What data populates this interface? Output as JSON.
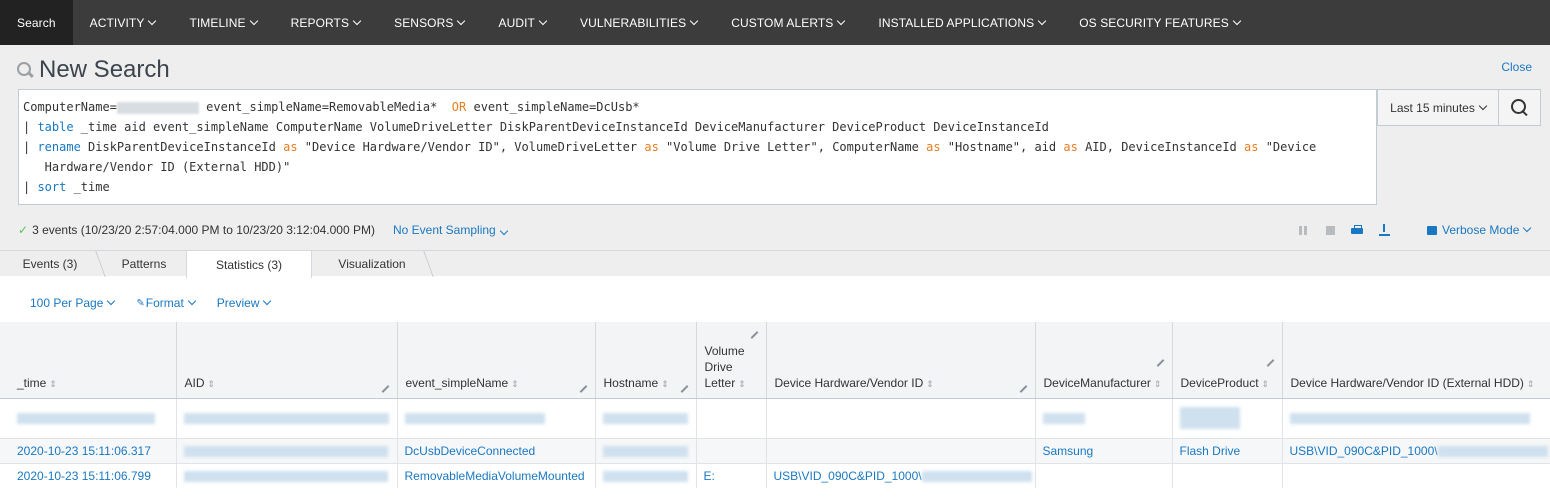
{
  "nav": {
    "items": [
      {
        "label": "Search",
        "active": true,
        "dropdown": false
      },
      {
        "label": "ACTIVITY",
        "dropdown": true
      },
      {
        "label": "TIMELINE",
        "dropdown": true
      },
      {
        "label": "REPORTS",
        "dropdown": true
      },
      {
        "label": "SENSORS",
        "dropdown": true
      },
      {
        "label": "AUDIT",
        "dropdown": true
      },
      {
        "label": "VULNERABILITIES",
        "dropdown": true
      },
      {
        "label": "CUSTOM ALERTS",
        "dropdown": true
      },
      {
        "label": "INSTALLED APPLICATIONS",
        "dropdown": true
      },
      {
        "label": "OS SECURITY FEATURES",
        "dropdown": true
      }
    ]
  },
  "search": {
    "title": "New Search",
    "close_label": "Close",
    "time_range": "Last 15 minutes",
    "query": {
      "l1_a": "ComputerName=",
      "l1_b": " event_simpleName=RemovableMedia*  ",
      "l1_or": "OR",
      "l1_c": " event_simpleName=DcUsb*",
      "pipe": "| ",
      "table_kw": "table",
      "table_args": " _time aid event_simpleName ComputerName VolumeDriveLetter DiskParentDeviceInstanceId DeviceManufacturer DeviceProduct DeviceInstanceId",
      "rename_kw": "rename",
      "as_kw": "as",
      "r1": " DiskParentDeviceInstanceId ",
      "r2": " \"Device Hardware/Vendor ID\", VolumeDriveLetter ",
      "r3": " \"Volume Drive Letter\", ComputerName ",
      "r4": " \"Hostname\", aid ",
      "r5": " AID, DeviceInstanceId ",
      "r6": " \"Device",
      "r7": "   Hardware/Vendor ID (External HDD)\"",
      "sort_kw": "sort",
      "sort_args": " _time"
    }
  },
  "status": {
    "check": "✓",
    "events_summary": "3 events (10/23/20 2:57:04.000 PM to 10/23/20 3:12:04.000 PM)",
    "sampling": "No Event Sampling",
    "mode": "Verbose Mode"
  },
  "tabs": [
    {
      "label": "Events (3)"
    },
    {
      "label": "Patterns"
    },
    {
      "label": "Statistics (3)",
      "active": true
    },
    {
      "label": "Visualization"
    }
  ],
  "options": {
    "per_page": "100 Per Page",
    "format": "Format",
    "preview": "Preview"
  },
  "table": {
    "columns": [
      "_time",
      "AID",
      "event_simpleName",
      "Hostname",
      "Volume Drive Letter",
      "Device Hardware/Vendor ID",
      "DeviceManufacturer",
      "DeviceProduct",
      "Device Hardware/Vendor ID (External HDD)"
    ],
    "rows": [
      {
        "time": "2020-10-23 15:11:06.317",
        "event": "DcUsbDeviceConnected",
        "drive": "",
        "hwid": "",
        "manufacturer": "Samsung",
        "product": "Flash Drive",
        "ext": "USB\\VID_090C&PID_1000\\"
      },
      {
        "time": "2020-10-23 15:11:06.799",
        "event": "RemovableMediaVolumeMounted",
        "drive": "E:",
        "hwid": "USB\\VID_090C&PID_1000\\",
        "manufacturer": "",
        "product": "",
        "ext": ""
      }
    ]
  },
  "colors": {
    "accent": "#1a78c2",
    "nav_bg": "#3c3c3c",
    "panel_bg": "#eeeeee",
    "keyword_or": "#e67e22"
  }
}
